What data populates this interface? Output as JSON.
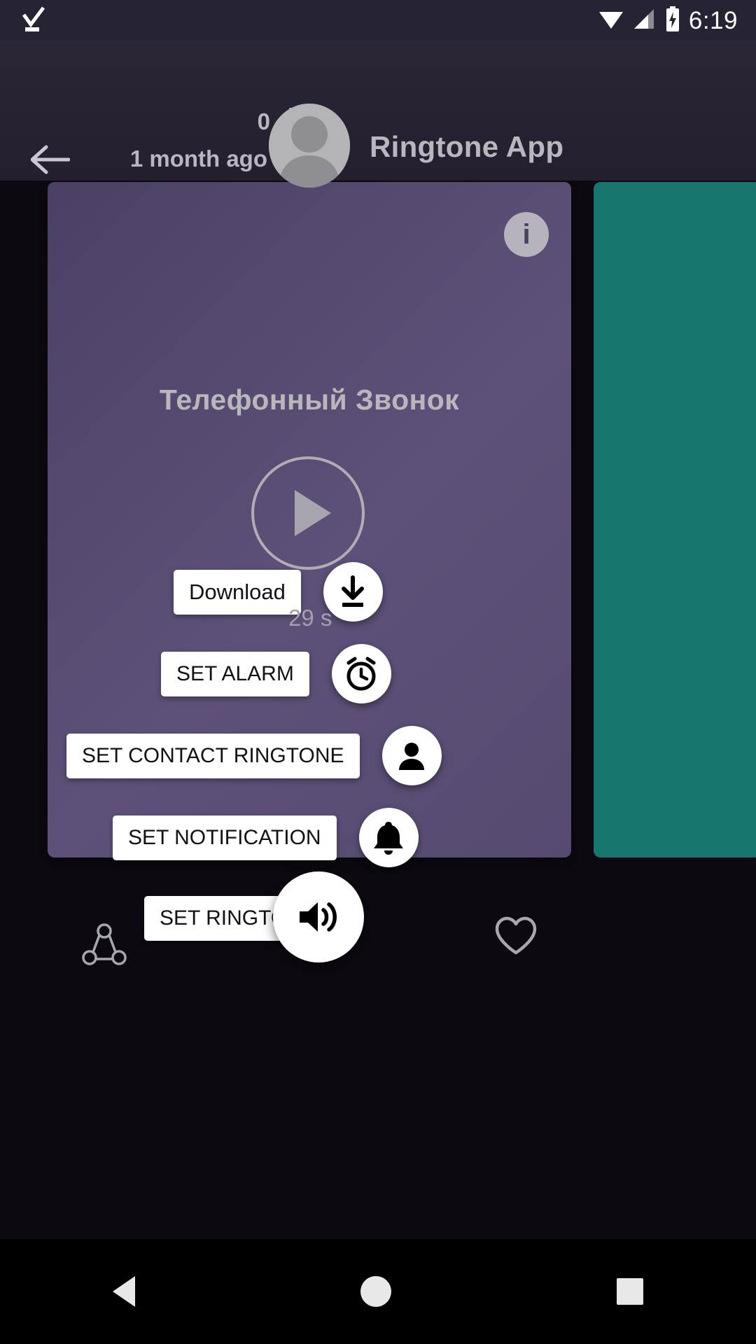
{
  "statusbar": {
    "time": "6:19",
    "icons": [
      "download-complete-icon",
      "wifi-icon",
      "cellular-signal-icon",
      "battery-charging-icon"
    ]
  },
  "header": {
    "back_icon": "arrow-back-icon",
    "download_count": "0",
    "download_icon": "download-icon",
    "age": "1 month ago",
    "clock_icon": "clock-icon",
    "avatar_icon": "avatar-placeholder-icon",
    "title": "Ringtone App"
  },
  "card": {
    "info_label": "i",
    "info_icon": "info-icon",
    "track_title": "Телефонный Звонок",
    "play_icon": "play-icon",
    "duration": "29 s",
    "accent_color": "#574a71",
    "next_card_color": "#17766d",
    "actions": [
      {
        "label": "Download",
        "icon": "download-icon"
      },
      {
        "label": "SET ALARM",
        "icon": "alarm-icon"
      },
      {
        "label": "SET CONTACT RINGTONE",
        "icon": "person-icon"
      },
      {
        "label": "SET NOTIFICATION",
        "icon": "bell-icon"
      },
      {
        "label": "SET RINGTONE",
        "icon": "volume-up-icon"
      }
    ]
  },
  "bottom": {
    "share_icon": "share-icon",
    "favorite_icon": "heart-outline-icon"
  },
  "navbar": {
    "back": "nav-back-icon",
    "home": "nav-home-icon",
    "recents": "nav-recents-icon"
  }
}
